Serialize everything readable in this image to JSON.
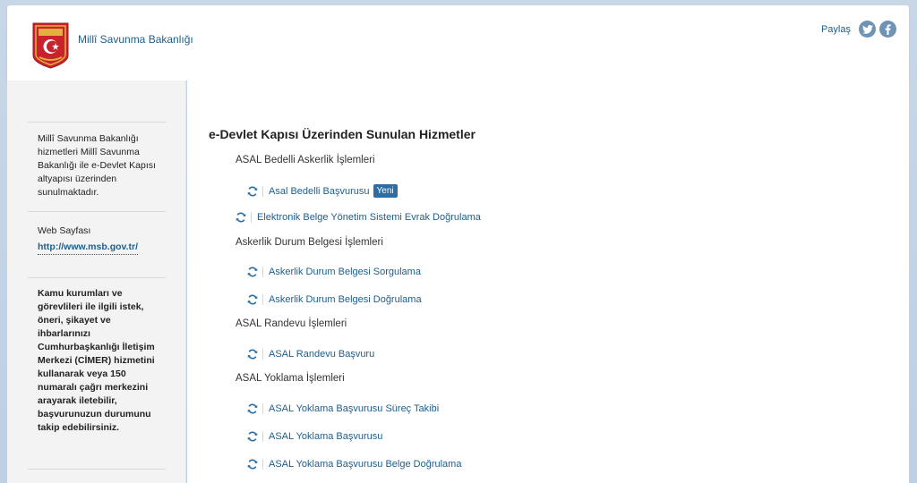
{
  "header": {
    "org_name": "Millî Savunma Bakanlığı",
    "share_label": "Paylaş",
    "share_twitter_icon": "twitter-icon",
    "share_facebook_icon": "facebook-icon",
    "brand_color": "#1d5e8c"
  },
  "sidebar": {
    "intro": "Millî Savunma Bakanlığı hizmetleri Millî Savunma Bakanlığı ile e-Devlet Kapısı altyapısı üzerinden sunulmaktadır.",
    "web_label": "Web Sayfası",
    "web_link": "http://www.msb.gov.tr/",
    "cimer_text": "Kamu kurumları ve görevlileri ile ilgili istek, öneri, şikayet ve ihbarlarınızı Cumhurbaşkanlığı İletişim Merkezi (CİMER) hizmetini kullanarak veya 150 numaralı çağrı merkezini arayarak iletebilir, başvurunuzun durumunu takip edebilirsiniz."
  },
  "main": {
    "title": "e-Devlet Kapısı Üzerinden Sunulan Hizmetler",
    "groups": [
      {
        "label": "ASAL Bedelli Askerlik İşlemleri"
      },
      {
        "label": "Askerlik Durum Belgesi İşlemleri"
      },
      {
        "label": "ASAL Randevu İşlemleri"
      },
      {
        "label": "ASAL Yoklama İşlemleri"
      }
    ],
    "services": [
      {
        "label": "Asal Bedelli Başvurusu",
        "badge": "Yeni"
      },
      {
        "label": "Elektronik Belge Yönetim Sistemi Evrak Doğrulama"
      },
      {
        "label": "Askerlik Durum Belgesi Sorgulama"
      },
      {
        "label": "Askerlik Durum Belgesi Doğrulama"
      },
      {
        "label": "ASAL Randevu Başvuru"
      },
      {
        "label": "ASAL Yoklama Başvurusu Süreç Takibi"
      },
      {
        "label": "ASAL Yoklama Başvurusu"
      },
      {
        "label": "ASAL Yoklama Başvurusu Belge Doğrulama"
      }
    ],
    "service_icon": "refresh-icon"
  }
}
